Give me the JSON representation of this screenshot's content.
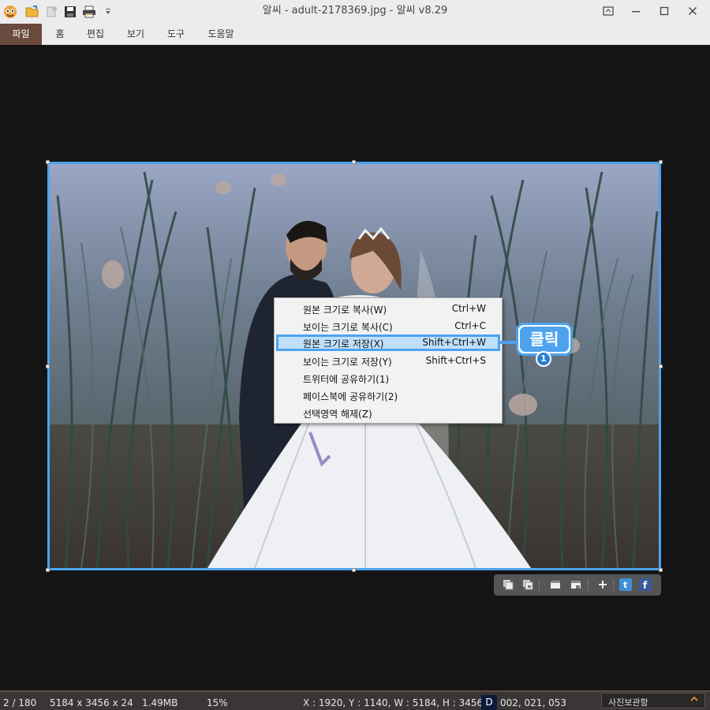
{
  "window": {
    "title": "알씨 - adult-2178369.jpg - 알씨 v8.29"
  },
  "menubar": {
    "items": [
      "파일",
      "홈",
      "편집",
      "보기",
      "도구",
      "도움말"
    ]
  },
  "context_menu": {
    "items": [
      {
        "label": "원본 크기로 복사(W)",
        "shortcut": "Ctrl+W"
      },
      {
        "label": "보이는 크기로 복사(C)",
        "shortcut": "Ctrl+C"
      },
      {
        "label": "원본 크기로 저장(X)",
        "shortcut": "Shift+Ctrl+W",
        "highlighted": true
      },
      {
        "label": "보이는 크기로 저장(Y)",
        "shortcut": "Shift+Ctrl+S"
      },
      {
        "label": "트위터에 공유하기(1)",
        "shortcut": ""
      },
      {
        "label": "페이스북에 공유하기(2)",
        "shortcut": ""
      },
      {
        "label": "선택영역 해제(Z)",
        "shortcut": ""
      }
    ]
  },
  "callout": {
    "text": "클릭",
    "step": "1"
  },
  "mini_toolbar": {
    "icons": [
      "copy-original-icon",
      "copy-visible-icon",
      "save-original-icon",
      "save-visible-icon",
      "zoom-plus-icon",
      "twitter-icon",
      "facebook-icon"
    ]
  },
  "status": {
    "index": "2 / 180",
    "dimensions": "5184 x 3456 x 24",
    "filesize": "1.49MB",
    "zoom": "15%",
    "selection": "X : 1920, Y : 1140, W : 5184, H : 3456",
    "badge": "D",
    "rgb": "002, 021, 053",
    "gallery_label": "사진보관함"
  },
  "colors": {
    "accent": "#4da3ee",
    "file_menu": "#6b4a3e",
    "statusbar": "#3b3636"
  }
}
